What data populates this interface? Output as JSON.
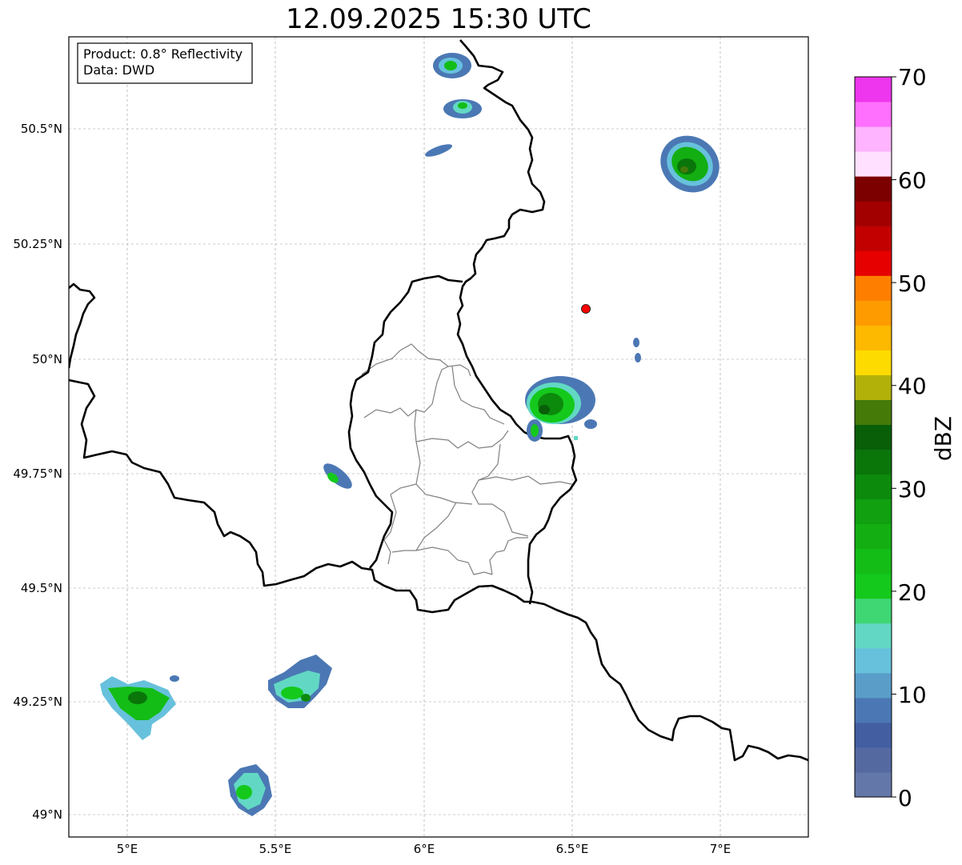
{
  "title": "12.09.2025 15:30 UTC",
  "info_box": {
    "product": "Product: 0.8° Reflectivity",
    "data": "Data: DWD"
  },
  "axes": {
    "x_ticks": [
      "5°E",
      "5.5°E",
      "6°E",
      "6.5°E",
      "7°E"
    ],
    "y_ticks": [
      "50.5°N",
      "50.25°N",
      "50°N",
      "49.75°N",
      "49.5°N",
      "49.25°N",
      "49°N"
    ]
  },
  "colorbar": {
    "label": "dBZ",
    "ticks": [
      "0",
      "10",
      "20",
      "30",
      "40",
      "50",
      "60",
      "70"
    ],
    "colors": [
      "#6477a9",
      "#5569a1",
      "#435ea1",
      "#4b78b4",
      "#5a9dc9",
      "#67c1dc",
      "#62d8c4",
      "#3fd674",
      "#14c91c",
      "#13bd16",
      "#13af12",
      "#10a010",
      "#0c8a0c",
      "#0a760a",
      "#085f08",
      "#457a09",
      "#b1b10a",
      "#fedb00",
      "#fdb800",
      "#fd9b00",
      "#fe7f00",
      "#e60000",
      "#c20000",
      "#a20000",
      "#7c0000",
      "#ffe1ff",
      "#feb4fe",
      "#ff70fe",
      "#ed36ee"
    ]
  },
  "radar_site": {
    "lon": 6.547,
    "lat": 50.11,
    "color": "#ff0000"
  },
  "map": {
    "lon_range": [
      4.8,
      7.3
    ],
    "lat_range": [
      48.95,
      50.7
    ]
  },
  "cells": [
    {
      "name": "cell-top-left",
      "lon": 6.09,
      "lat": 50.64,
      "level": "moderate"
    },
    {
      "name": "cell-top-left-2",
      "lon": 6.13,
      "lat": 50.54,
      "level": "moderate"
    },
    {
      "name": "cell-northeast",
      "lon": 6.9,
      "lat": 50.42,
      "level": "strong"
    },
    {
      "name": "cell-center",
      "lon": 6.44,
      "lat": 49.88,
      "level": "strong"
    },
    {
      "name": "cell-small-west",
      "lon": 5.69,
      "lat": 49.74,
      "level": "weak"
    },
    {
      "name": "cell-southwest",
      "lon": 5.05,
      "lat": 49.25,
      "level": "moderate"
    },
    {
      "name": "cell-south-middle",
      "lon": 5.6,
      "lat": 49.27,
      "level": "moderate"
    },
    {
      "name": "cell-south",
      "lon": 5.42,
      "lat": 49.05,
      "level": "moderate"
    }
  ]
}
